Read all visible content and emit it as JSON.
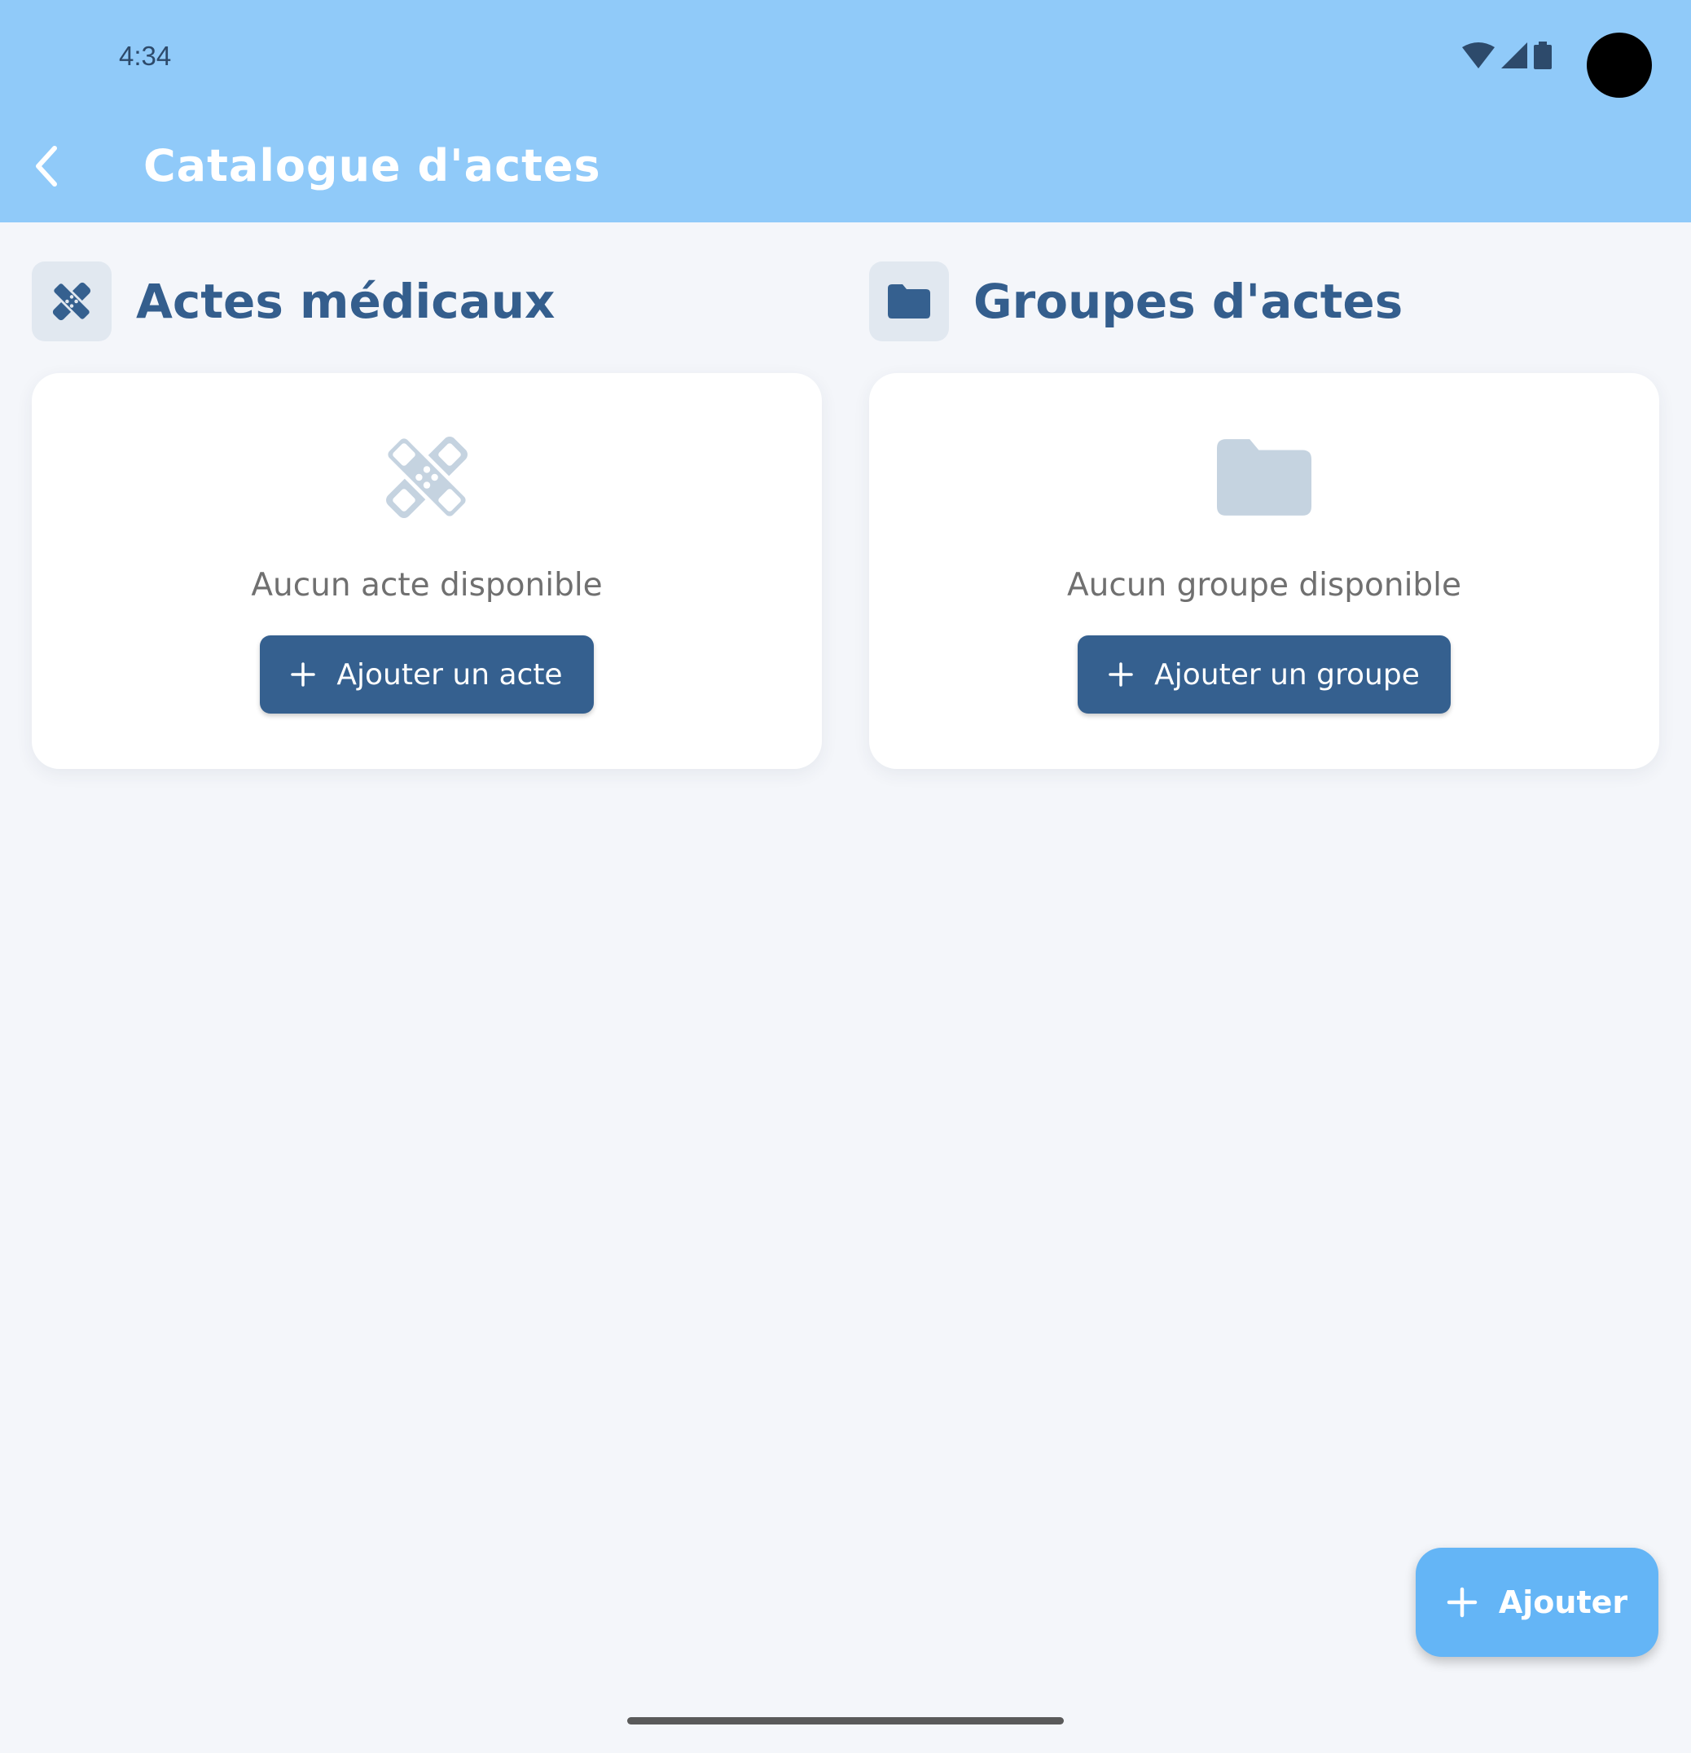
{
  "status_bar": {
    "time": "4:34",
    "icons": [
      "wifi-icon",
      "signal-icon",
      "battery-icon"
    ]
  },
  "app_bar": {
    "back_icon": "chevron-left-icon",
    "title": "Catalogue d'actes",
    "background_color": "#90caf9"
  },
  "sections": [
    {
      "icon": "bandage-icon",
      "title": "Actes médicaux",
      "empty_text": "Aucun acte disponible",
      "button_label": "Ajouter un acte"
    },
    {
      "icon": "folder-icon",
      "title": "Groupes d'actes",
      "empty_text": "Aucun groupe disponible",
      "button_label": "Ajouter un groupe"
    }
  ],
  "fab": {
    "icon": "plus-icon",
    "label": "Ajouter",
    "color": "#64b5f6"
  },
  "colors": {
    "primary": "#35608f",
    "background": "#f4f6fa",
    "muted_icon": "#c5d3e0"
  }
}
